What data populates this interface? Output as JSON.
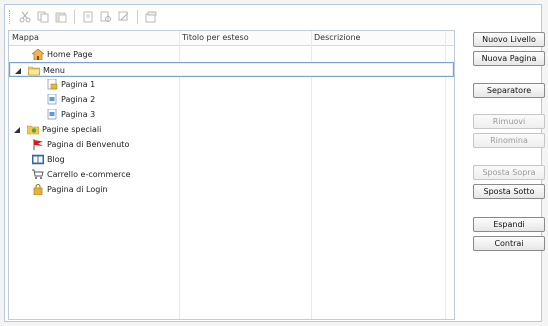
{
  "toolbar": {
    "buttons": [
      {
        "icon": "cut-icon"
      },
      {
        "icon": "copy-icon"
      },
      {
        "icon": "paste-icon"
      },
      {
        "icon": "page-icon"
      },
      {
        "icon": "find-icon"
      },
      {
        "icon": "find-replace-icon"
      },
      {
        "icon": "properties-icon"
      }
    ]
  },
  "tree": {
    "columns": [
      "Mappa",
      "Titolo per esteso",
      "Descrizione"
    ],
    "rows": [
      {
        "label": "Home Page",
        "icon": "home-icon",
        "level": 1,
        "expander": ""
      },
      {
        "label": "Menu",
        "icon": "folder-icon",
        "level": 0,
        "expander": "expanded",
        "selected": true
      },
      {
        "label": "Pagina 1",
        "icon": "page-lock-icon",
        "level": 2,
        "expander": ""
      },
      {
        "label": "Pagina 2",
        "icon": "page-icon",
        "level": 2,
        "expander": ""
      },
      {
        "label": "Pagina 3",
        "icon": "page-icon",
        "level": 2,
        "expander": ""
      },
      {
        "label": "Pagine speciali",
        "icon": "special-folder-icon",
        "level": 0,
        "expander": "expanded"
      },
      {
        "label": "Pagina di Benvenuto",
        "icon": "flag-icon",
        "level": 1,
        "expander": ""
      },
      {
        "label": "Blog",
        "icon": "blog-icon",
        "level": 1,
        "expander": ""
      },
      {
        "label": "Carrello e-commerce",
        "icon": "cart-icon",
        "level": 1,
        "expander": ""
      },
      {
        "label": "Pagina di Login",
        "icon": "lock-icon",
        "level": 1,
        "expander": ""
      }
    ]
  },
  "buttons": {
    "nuovo_livello": "Nuovo Livello",
    "nuova_pagina": "Nuova Pagina",
    "separatore": "Separatore",
    "rimuovi": "Rimuovi",
    "rinomina": "Rinomina",
    "sposta_sopra": "Sposta Sopra",
    "sposta_sotto": "Sposta Sotto",
    "espandi": "Espandi",
    "contrai": "Contrai"
  },
  "colors": {
    "frame_border": "#b9c9de",
    "selection_border": "#7aa2d6",
    "folder": "#e8c64a",
    "flag": "#d11f1f"
  }
}
